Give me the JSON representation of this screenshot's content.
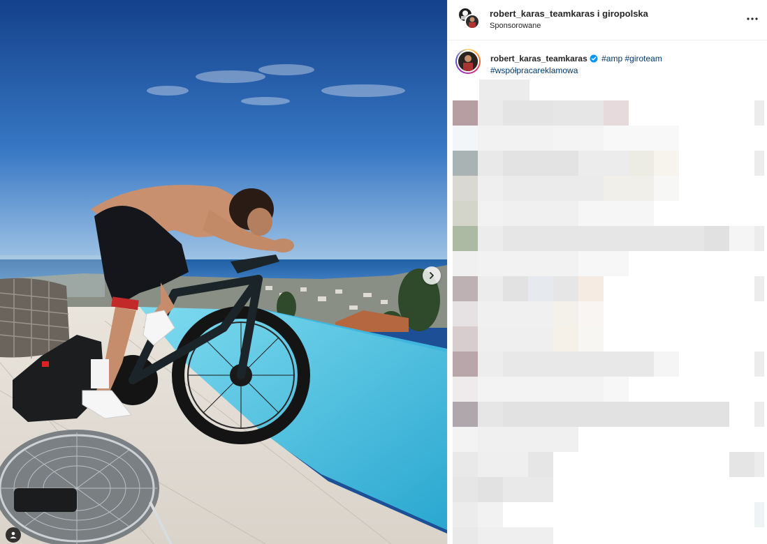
{
  "post": {
    "header": {
      "names": "robert_karas_teamkaras i giropolska",
      "sponsored": "Sponsorowane"
    },
    "caption": {
      "username": "robert_karas_teamkaras",
      "tags": [
        "#amp",
        "#giroteam",
        "#współpracareklamowa"
      ]
    },
    "icons": {
      "more": "more-options-icon",
      "verified": "verified-badge-icon",
      "next": "chevron-right-icon",
      "tagged": "user-tag-icon"
    },
    "colors": {
      "hashtag": "#00376b",
      "verified": "#0095f6",
      "sky": "#1d4f96",
      "pool": "#3fb8d8"
    }
  }
}
